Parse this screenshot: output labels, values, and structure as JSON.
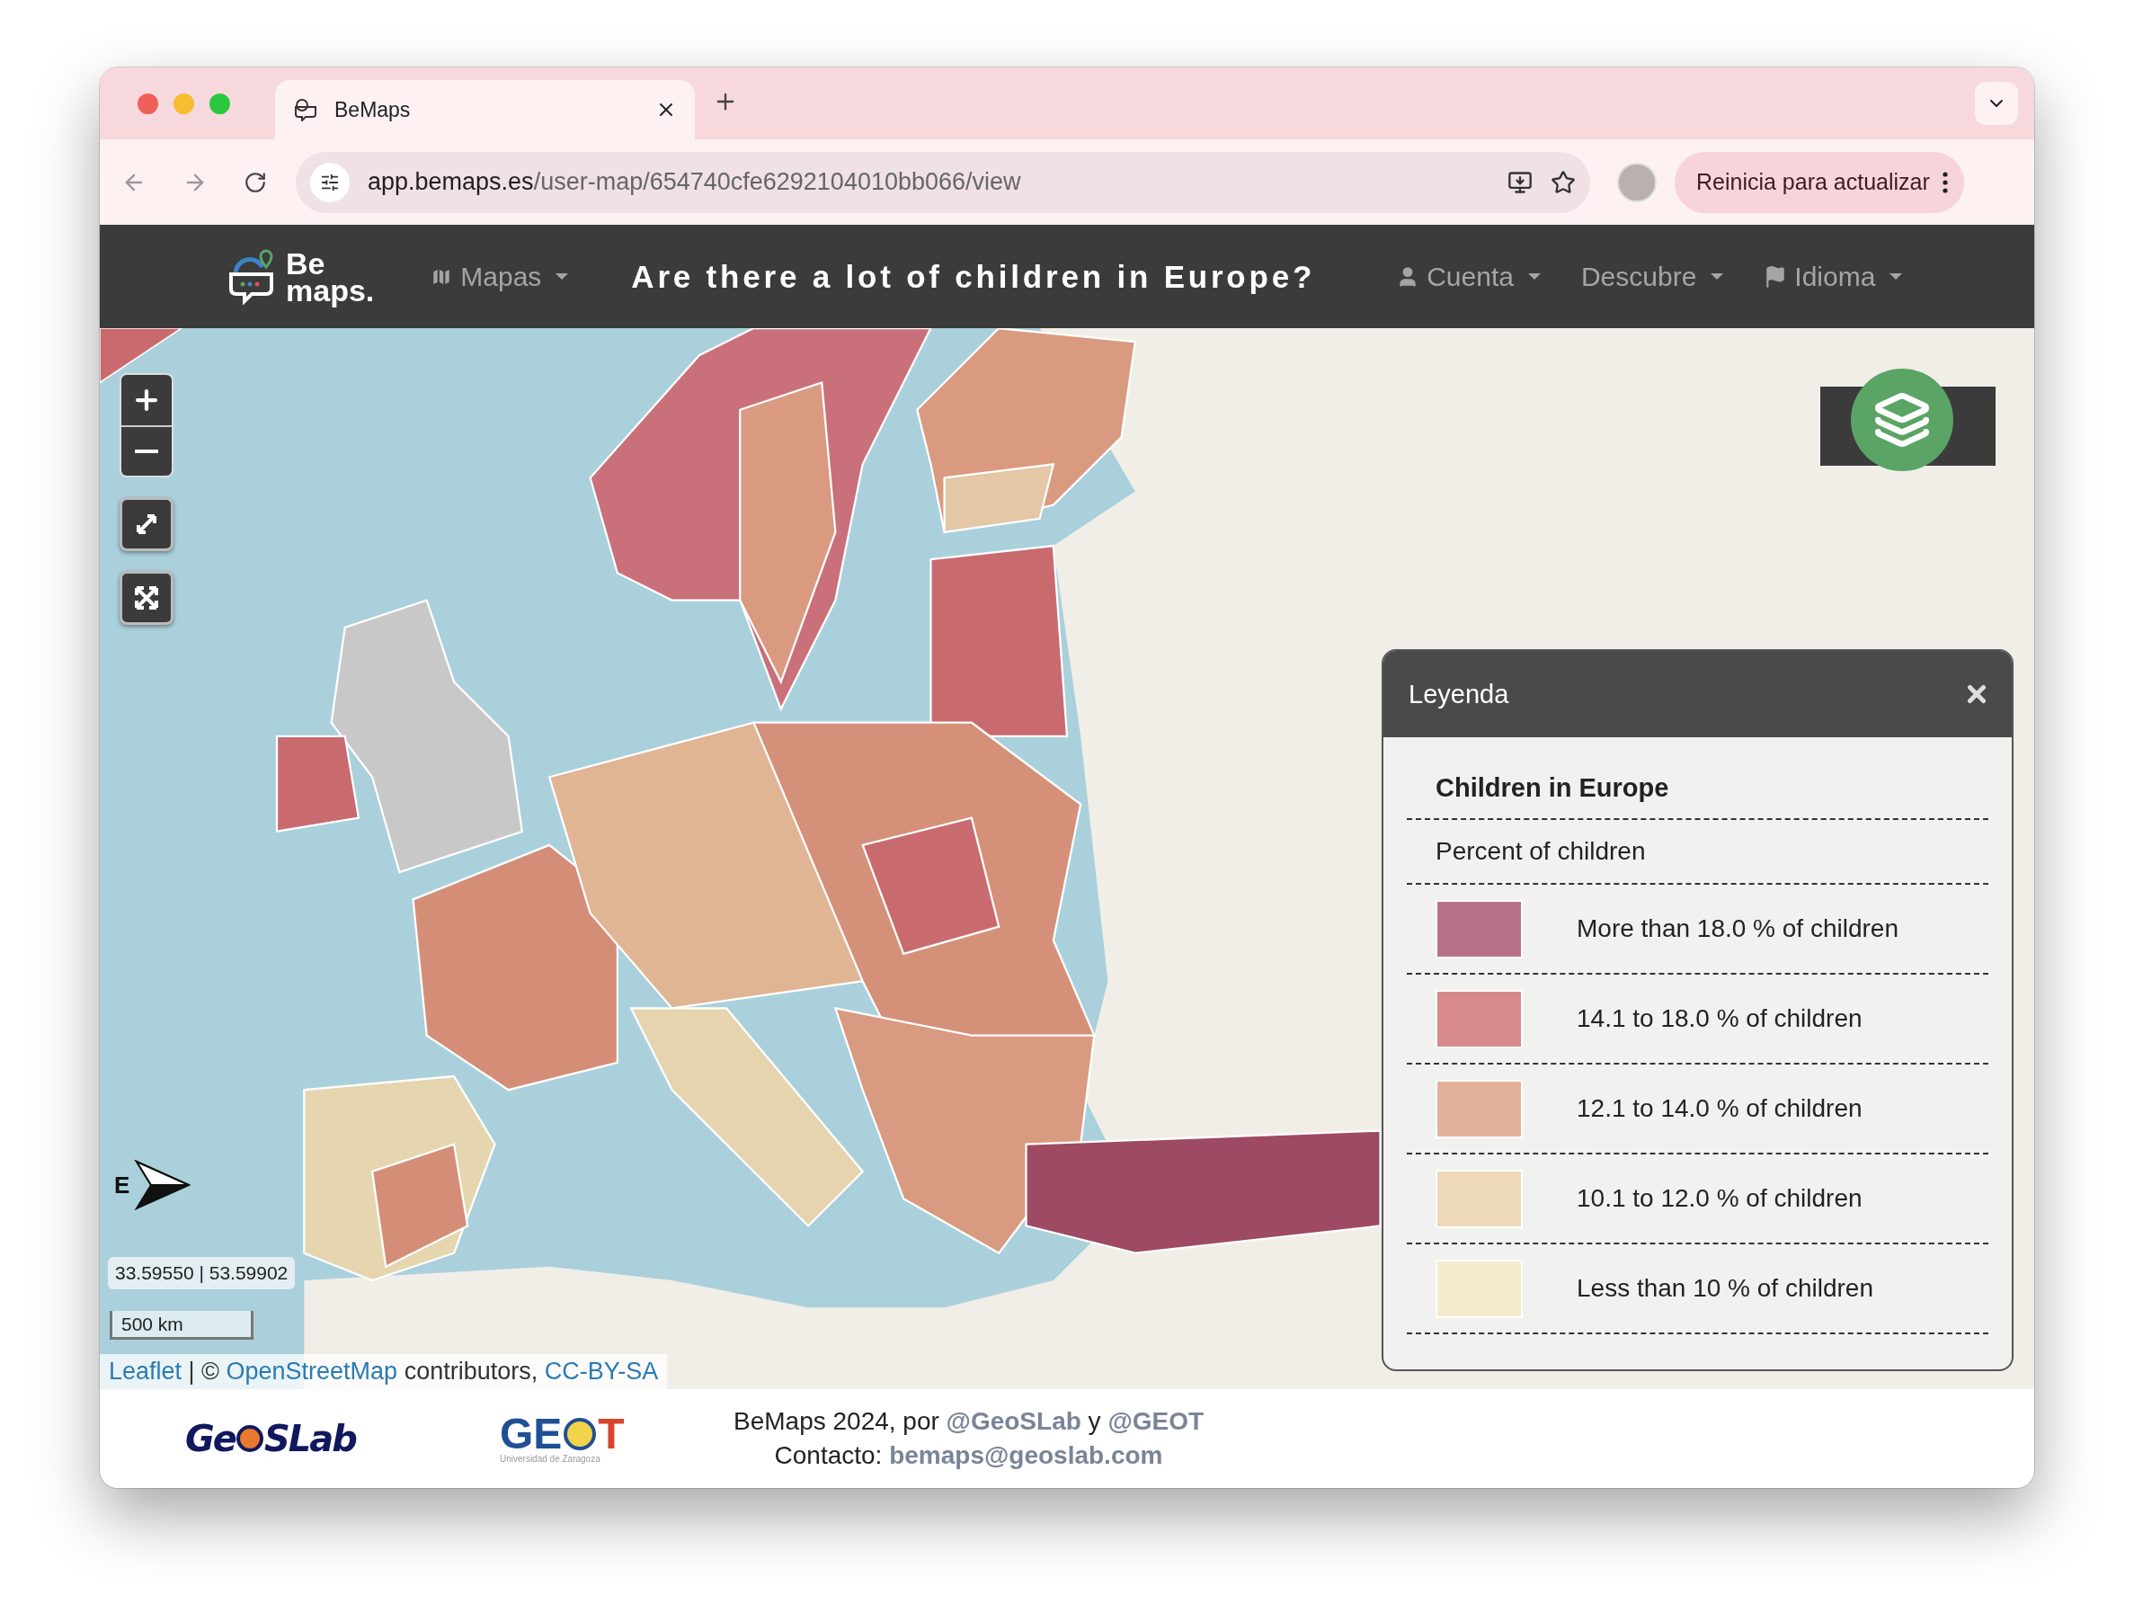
{
  "browser": {
    "tab": {
      "title": "BeMaps"
    },
    "url": {
      "host": "app.bemaps.es",
      "path": "/user-map/654740cfe6292104010bb066/view"
    },
    "update_button": "Reinicia para actualizar"
  },
  "navbar": {
    "brand": [
      "Be",
      "maps."
    ],
    "left_menus": [
      {
        "label": "Mapas"
      }
    ],
    "title": "Are there a lot of children in Europe?",
    "right_menus": [
      {
        "label": "Cuenta"
      },
      {
        "label": "Descubre"
      },
      {
        "label": "Idioma"
      }
    ]
  },
  "map": {
    "north_label": "E",
    "coordinates": "33.59550 | 53.59902",
    "scale": "500 km",
    "attribution": [
      {
        "text": "Leaflet",
        "link": true
      },
      {
        "text": "| ©",
        "link": false
      },
      {
        "text": "OpenStreetMap",
        "link": true
      },
      {
        "text": "contributors,",
        "link": false
      },
      {
        "text": "CC-BY-SA",
        "link": true
      }
    ]
  },
  "legend": {
    "title": "Leyenda",
    "layer": "Children in Europe",
    "variable": "Percent of children",
    "items": [
      {
        "label": "More than 18.0 % of children",
        "color": "#b87287"
      },
      {
        "label": "14.1 to 18.0 % of children",
        "color": "#d88a8b"
      },
      {
        "label": "12.1 to 14.0 % of children",
        "color": "#e2b199"
      },
      {
        "label": "10.1 to 12.0 % of children",
        "color": "#eed9b9"
      },
      {
        "label": "Less than 10 % of children",
        "color": "#f5ebcc"
      }
    ]
  },
  "footer": {
    "logos": [
      {
        "kind": "geoslab",
        "parts": [
          "Ge",
          "SLab"
        ]
      },
      {
        "kind": "geot",
        "parts": [
          "GE",
          "T"
        ],
        "subtitle": "Universidad de Zaragoza"
      }
    ],
    "lines": [
      {
        "parts": [
          {
            "text": "BeMaps 2024, por",
            "link": false
          },
          {
            "text": "@GeoSLab",
            "link": true
          },
          {
            "text": "y",
            "link": false
          },
          {
            "text": "@GEOT",
            "link": true
          }
        ]
      },
      {
        "parts": [
          {
            "text": "Contacto:",
            "link": false
          },
          {
            "text": "bemaps@geoslab.com",
            "link": true
          }
        ]
      }
    ]
  }
}
